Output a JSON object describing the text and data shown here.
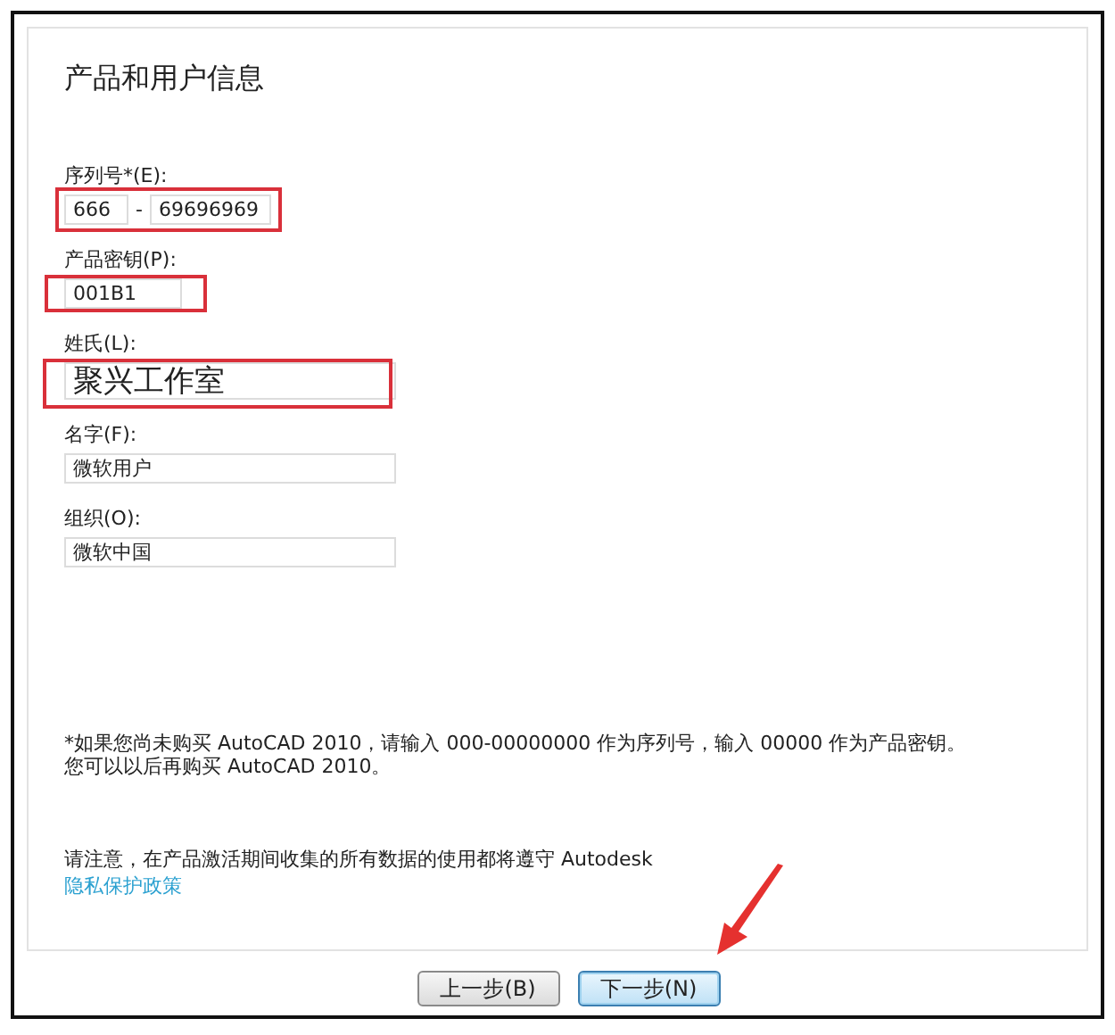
{
  "panel": {
    "title": "产品和用户信息"
  },
  "fields": [
    {
      "kind": "serial",
      "label": "序列号*(E):",
      "parts": [
        "666",
        "69696969"
      ],
      "separator": "-",
      "highlighted": true
    },
    {
      "kind": "short",
      "label": "产品密钥(P):",
      "value": "001B1",
      "highlighted": true
    },
    {
      "kind": "large",
      "label": "姓氏(L):",
      "value": "聚兴工作室",
      "highlighted": true
    },
    {
      "kind": "text",
      "label": "名字(F):",
      "value": "微软用户",
      "highlighted": false
    },
    {
      "kind": "text",
      "label": "组织(O):",
      "value": "微软中国",
      "highlighted": false
    }
  ],
  "note": [
    "*如果您尚未购买 AutoCAD 2010，请输入 000-00000000 作为序列号，输入 00000 作为产品密钥。",
    "您可以以后再购买 AutoCAD 2010。"
  ],
  "privacy": {
    "text": "请注意，在产品激活期间收集的所有数据的使用都将遵守 Autodesk",
    "link": "隐私保护政策"
  },
  "buttons": [
    {
      "label": "上一步(B)",
      "default": false,
      "pointed": false
    },
    {
      "label": "下一步(N)",
      "default": true,
      "pointed": true
    }
  ]
}
